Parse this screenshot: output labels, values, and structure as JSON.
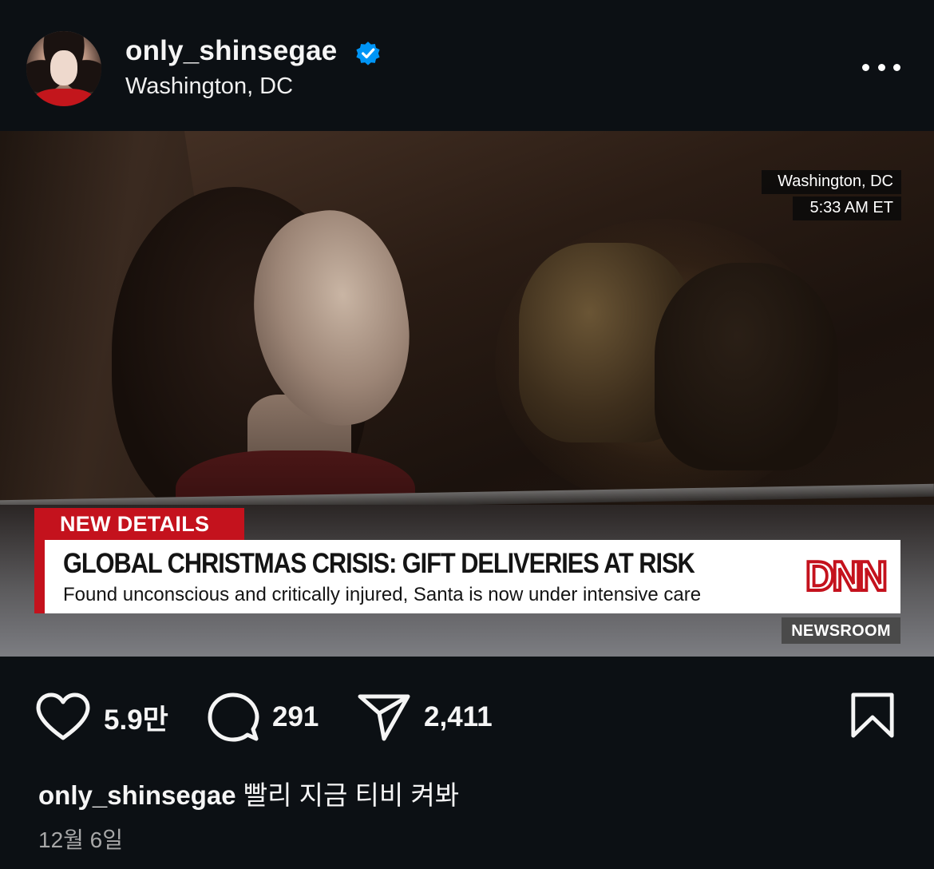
{
  "post": {
    "username": "only_shinsegae",
    "location": "Washington, DC",
    "verified": true,
    "more_icon": "more-horizontal-icon"
  },
  "photo": {
    "overlay": {
      "location": "Washington, DC",
      "time": "5:33 AM ET",
      "tag": "NEW DETAILS",
      "headline": "GLOBAL CHRISTMAS CRISIS: GIFT DELIVERIES AT RISK",
      "subheadline": "Found unconscious and critically injured, Santa is now under intensive care",
      "network_logo": "DNN",
      "program": "NEWSROOM"
    },
    "accent_color": "#c4121d"
  },
  "actions": {
    "likes": "5.9만",
    "comments": "291",
    "shares": "2,411",
    "like_icon": "heart-icon",
    "comment_icon": "comment-bubble-icon",
    "share_icon": "paper-plane-icon",
    "save_icon": "bookmark-icon"
  },
  "caption": {
    "username": "only_shinsegae",
    "text": "빨리 지금 티비 켜봐"
  },
  "date": "12월 6일"
}
